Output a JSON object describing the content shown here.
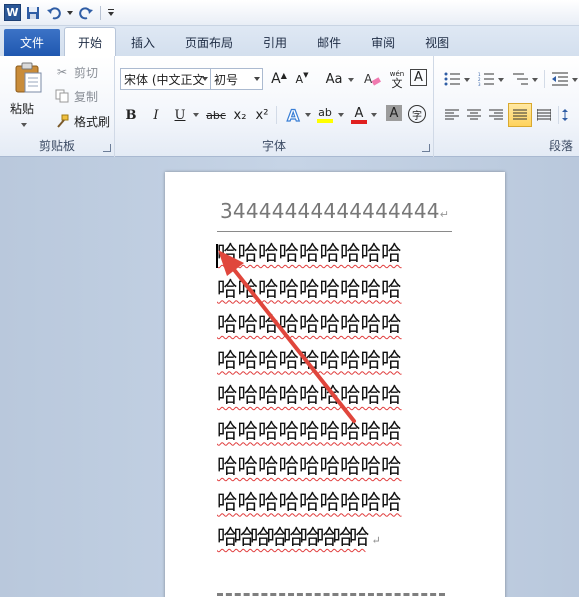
{
  "tabs": {
    "file": "文件",
    "home": "开始",
    "insert": "插入",
    "page_layout": "页面布局",
    "references": "引用",
    "mailings": "邮件",
    "review": "审阅",
    "view": "视图"
  },
  "clipboard": {
    "paste": "粘贴",
    "cut": "剪切",
    "copy": "复制",
    "format_painter": "格式刷",
    "label": "剪贴板"
  },
  "font": {
    "font_name": "宋体 (中文正文",
    "font_size": "初号",
    "label": "字体",
    "bold": "B",
    "italic": "I",
    "underline": "U",
    "strike": "abc",
    "subscript": "x₂",
    "superscript": "x²",
    "grow": "A",
    "shrink": "A",
    "change_case": "Aa",
    "clear_format": "A",
    "phonetic": "wén",
    "char_border": "A",
    "highlight": "ab",
    "font_color": "A",
    "char_shading": "A",
    "enclose": "字"
  },
  "paragraph": {
    "label": "段落"
  },
  "colors": {
    "accent": "#1f58b0",
    "font_color_bar": "#e02020",
    "highlight_bar": "#ffff00",
    "arrow": "#e0463c"
  },
  "document": {
    "heading": "34444444444444444",
    "paragraph_mark": "↵",
    "lines": [
      "哈哈哈哈哈哈哈哈哈",
      "哈哈哈哈哈哈哈哈哈",
      "哈哈哈哈哈哈哈哈哈",
      "哈哈哈哈哈哈哈哈哈",
      "哈哈哈哈哈哈哈哈哈",
      "哈哈哈哈哈哈哈哈哈",
      "哈哈哈哈哈哈哈哈哈",
      "哈哈哈哈哈哈哈哈哈",
      "哈哈哈哈哈哈哈哈哈"
    ]
  }
}
